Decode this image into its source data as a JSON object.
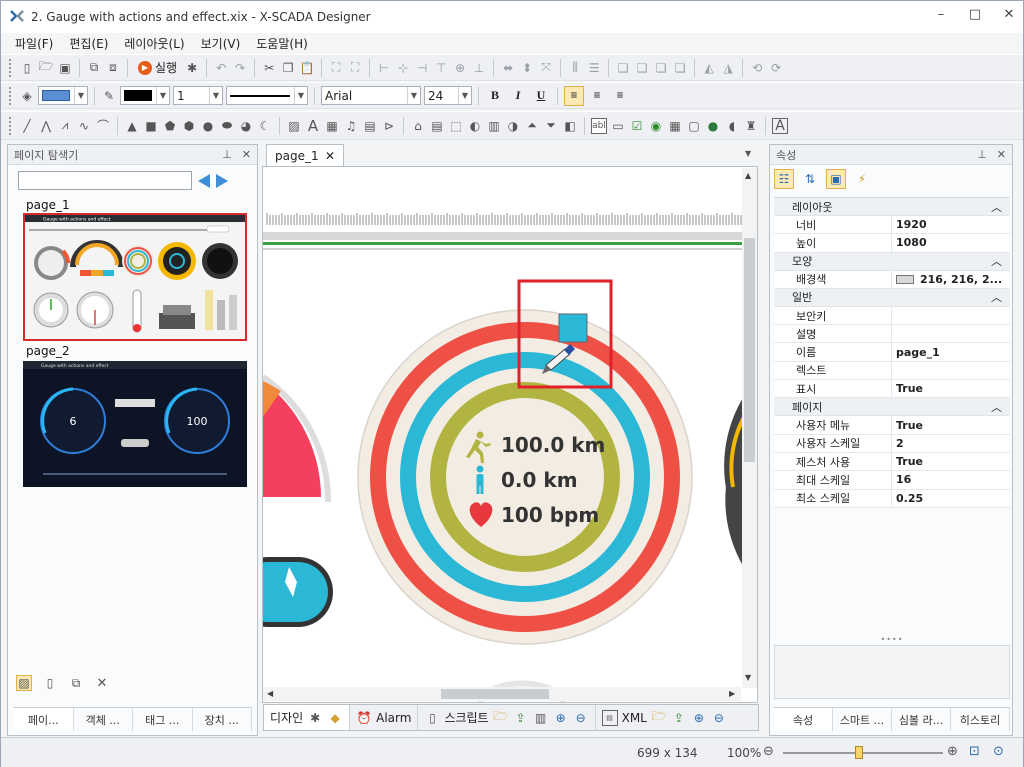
{
  "window": {
    "title": "2. Gauge with actions and effect.xix - X-SCADA Designer"
  },
  "menu": [
    "파일(F)",
    "편집(E)",
    "레이아웃(L)",
    "보기(V)",
    "도움말(H)"
  ],
  "toolbar": {
    "run_label": "실행",
    "line_width": "1",
    "font_name": "Arial",
    "font_size": "24",
    "bold": "B",
    "italic": "I",
    "underline": "U",
    "label_tool": "abl"
  },
  "left_panel": {
    "title": "페이지 탐색기",
    "pages": [
      "page_1",
      "page_2"
    ],
    "thumb1_title": "Gauge with actions and effect",
    "thumb2_title": "Gauge with actions and effect",
    "thumb2_values": [
      "6",
      "100"
    ],
    "tabs": [
      "페이...",
      "객체 ...",
      "태그 ...",
      "장치 ..."
    ]
  },
  "document": {
    "tab": "page_1",
    "gauge": {
      "distance": "100.0 km",
      "walk": "0.0 km",
      "heart": "100 bpm"
    },
    "bottom_tabs": [
      "디자인",
      "Alarm",
      "스크립트",
      "XML"
    ]
  },
  "right_panel": {
    "title": "속성",
    "categories": [
      {
        "name": "레이아웃",
        "rows": [
          {
            "n": "너비",
            "v": "1920"
          },
          {
            "n": "높이",
            "v": "1080"
          }
        ]
      },
      {
        "name": "모양",
        "rows": [
          {
            "n": "배경색",
            "v": "216, 216, 2...",
            "swatch": "#d8d8d8"
          }
        ]
      },
      {
        "name": "일반",
        "rows": [
          {
            "n": "보안키",
            "v": ""
          },
          {
            "n": "설명",
            "v": ""
          },
          {
            "n": "이름",
            "v": "page_1"
          },
          {
            "n": "렉스트",
            "v": ""
          },
          {
            "n": "표시",
            "v": "True"
          }
        ]
      },
      {
        "name": "페이지",
        "rows": [
          {
            "n": "사용자 메뉴",
            "v": "True"
          },
          {
            "n": "사용자 스케일",
            "v": "2"
          },
          {
            "n": "제스처 사용",
            "v": "True"
          },
          {
            "n": "최대 스케일",
            "v": "16"
          },
          {
            "n": "최소 스케일",
            "v": "0.25"
          }
        ]
      }
    ],
    "tabs": [
      "속성",
      "스마트 ...",
      "심볼 라...",
      "히스토리"
    ]
  },
  "status": {
    "size": "699 x 134",
    "zoom": "100%"
  },
  "colors": {
    "accent_red": "#d62b2b",
    "ring_red": "#ef5046",
    "ring_cyan": "#2bb8d6",
    "ring_olive": "#b2b441",
    "gauge_bg": "#f3ece2"
  }
}
